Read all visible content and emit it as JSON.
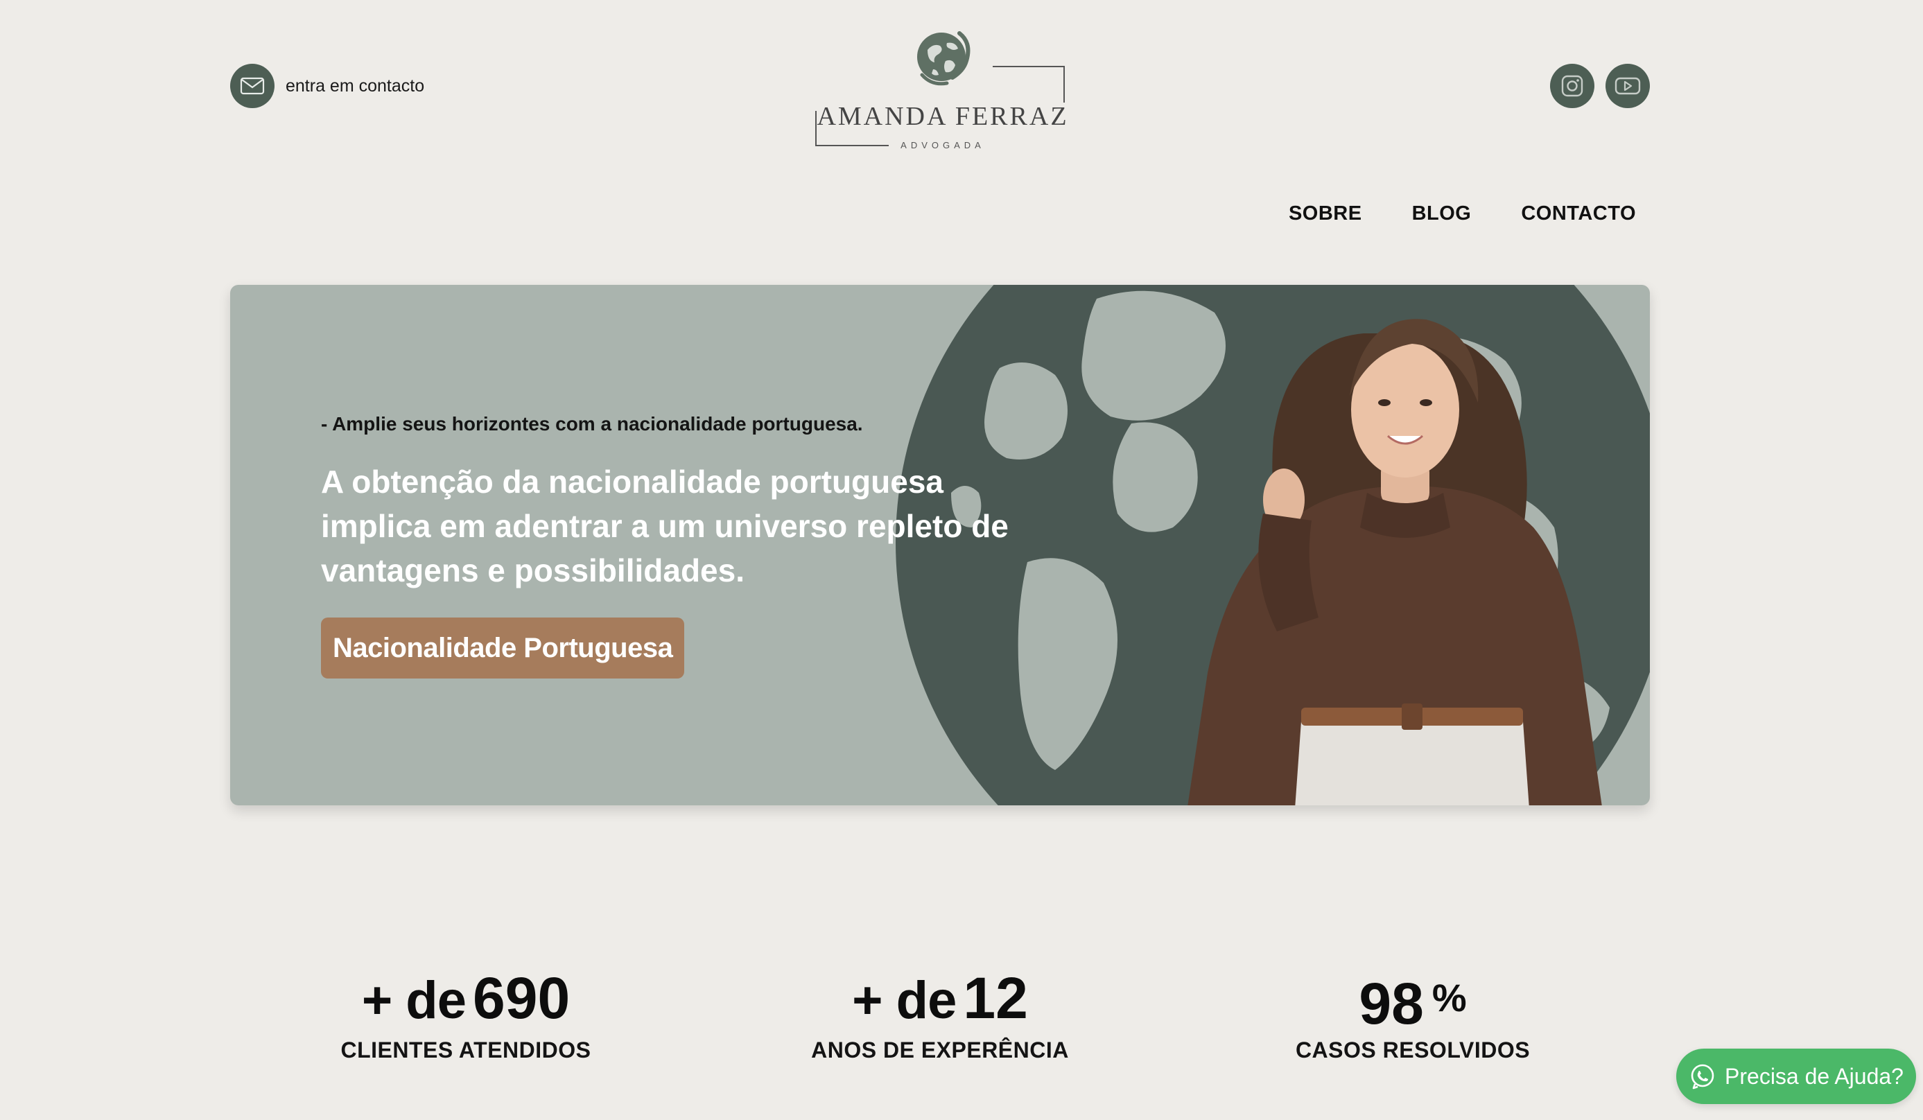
{
  "header": {
    "contact_label": "entra em contacto",
    "logo": {
      "name": "AMANDA FERRAZ",
      "subtitle": "ADVOGADA"
    },
    "socials": [
      {
        "icon": "instagram-icon"
      },
      {
        "icon": "youtube-icon"
      }
    ]
  },
  "nav": {
    "items": [
      {
        "label": "SOBRE"
      },
      {
        "label": "BLOG"
      },
      {
        "label": "CONTACTO"
      }
    ]
  },
  "hero": {
    "eyebrow": "- Amplie seus horizontes com a nacionalidade portuguesa.",
    "headline": "A obtenção da nacionalidade portuguesa implica em adentrar a um universo repleto de vantagens e possibilidades.",
    "cta_label": "Nacionalidade Portuguesa"
  },
  "stats": [
    {
      "prefix": "+ de",
      "value": "690",
      "suffix": "",
      "label": "CLIENTES ATENDIDOS"
    },
    {
      "prefix": "+ de",
      "value": "12",
      "suffix": "",
      "label": "ANOS DE EXPERÊNCIA"
    },
    {
      "prefix": "",
      "value": "98",
      "suffix": "%",
      "label": "CASOS RESOLVIDOS"
    }
  ],
  "whatsapp": {
    "label": "Precisa de Ajuda?"
  },
  "colors": {
    "background": "#eeece8",
    "brand_green": "#4d5e54",
    "hero_bg": "#aab4ae",
    "cta_brown": "#a67c5c",
    "whatsapp_green": "#4bb868"
  }
}
